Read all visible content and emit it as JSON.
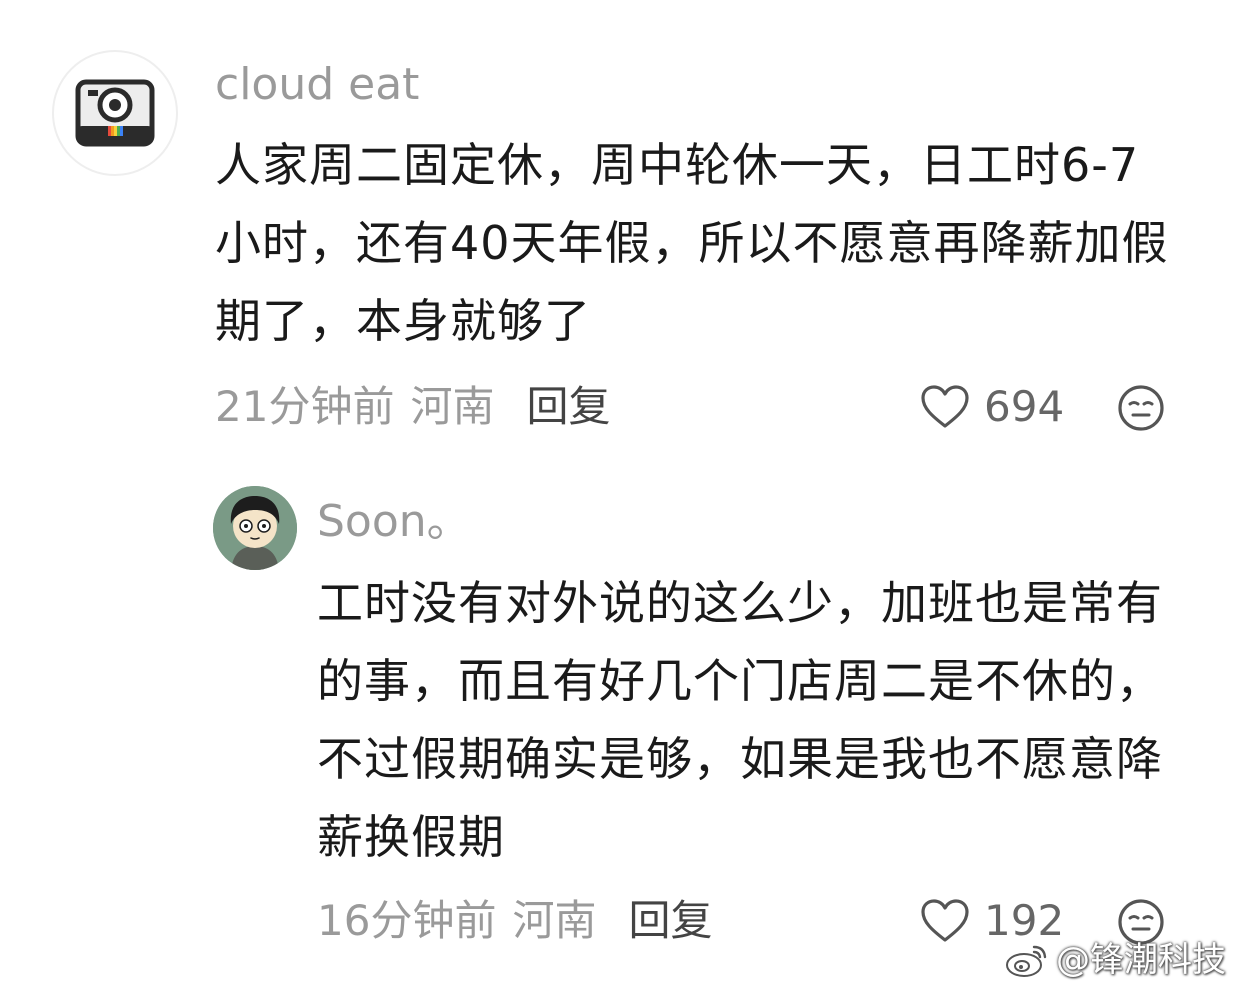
{
  "comments": [
    {
      "username": "cloud eat",
      "avatar_icon": "instant-camera-icon",
      "text": "人家周二固定休，周中轮休一天，日工时6-7小时，还有40天年假，所以不愿意再降薪加假期了，本身就够了",
      "time": "21分钟前",
      "location": "河南",
      "reply_label": "回复",
      "likes": "694",
      "like_icon": "heart-outline-icon",
      "react_icon": "neutral-face-icon"
    },
    {
      "username": "Soon。",
      "avatar_icon": "cartoon-boy-avatar",
      "text": "工时没有对外说的这么少，加班也是常有的事，而且有好几个门店周二是不休的，不过假期确实是够，如果是我也不愿意降薪换假期",
      "time": "16分钟前",
      "location": "河南",
      "reply_label": "回复",
      "likes": "192",
      "like_icon": "heart-outline-icon",
      "react_icon": "neutral-face-icon"
    }
  ],
  "watermark": {
    "text": "@锋潮科技",
    "icon": "weibo-logo-icon"
  },
  "colors": {
    "username": "#9a9a9a",
    "body_text": "#1a1a1a",
    "reply": "#444444"
  }
}
